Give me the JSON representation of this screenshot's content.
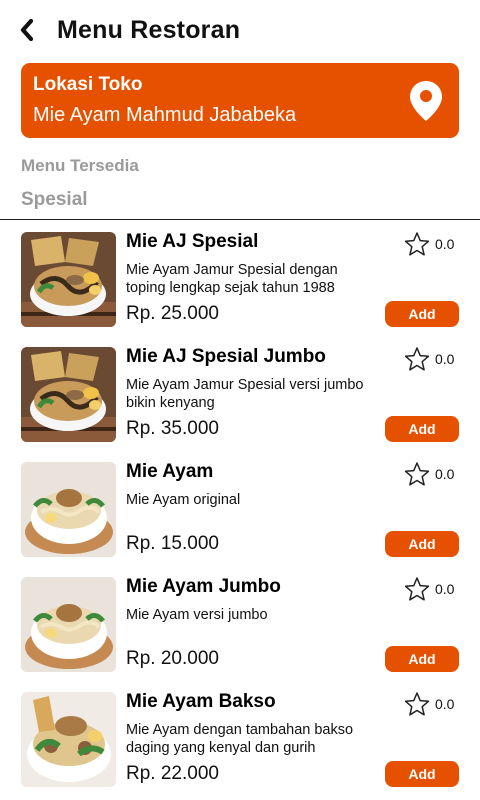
{
  "header": {
    "title": "Menu Restoran",
    "back_icon": "chevron-left-icon"
  },
  "store": {
    "label": "Lokasi Toko",
    "name": "Mie Ayam Mahmud Jababeka",
    "icon": "location-pin-icon",
    "color": "#e65100"
  },
  "menu": {
    "section_title": "Menu Tersedia",
    "category": "Spesial",
    "add_label": "Add",
    "items": [
      {
        "name": "Mie AJ Spesial",
        "description": "Mie Ayam Jamur Spesial dengan toping lengkap sejak tahun 1988",
        "price": "Rp. 25.000",
        "rating": "0.0"
      },
      {
        "name": "Mie AJ Spesial Jumbo",
        "description": "Mie Ayam Jamur Spesial versi jumbo bikin kenyang",
        "price": "Rp. 35.000",
        "rating": "0.0"
      },
      {
        "name": "Mie Ayam",
        "description": "Mie Ayam original",
        "price": "Rp. 15.000",
        "rating": "0.0"
      },
      {
        "name": "Mie Ayam Jumbo",
        "description": "Mie Ayam versi jumbo",
        "price": "Rp. 20.000",
        "rating": "0.0"
      },
      {
        "name": "Mie Ayam Bakso",
        "description": "Mie Ayam dengan tambahan bakso daging yang kenyal dan gurih",
        "price": "Rp. 22.000",
        "rating": "0.0"
      }
    ]
  }
}
